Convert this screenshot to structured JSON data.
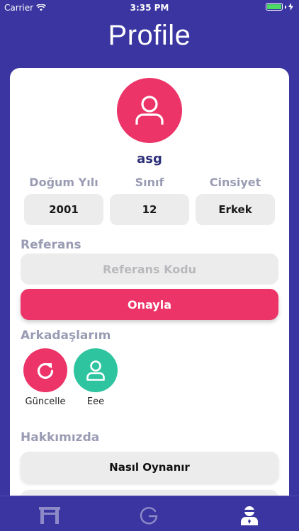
{
  "status_bar": {
    "carrier": "Carrier",
    "time": "3:35 PM"
  },
  "header": {
    "title": "Profile"
  },
  "profile": {
    "username": "asg",
    "fields": [
      {
        "label": "Doğum Yılı",
        "value": "2001"
      },
      {
        "label": "Sınıf",
        "value": "12"
      },
      {
        "label": "Cinsiyet",
        "value": "Erkek"
      }
    ]
  },
  "referral": {
    "section_label": "Referans",
    "placeholder": "Referans Kodu",
    "confirm_label": "Onayla"
  },
  "friends": {
    "section_label": "Arkadaşlarım",
    "items": [
      {
        "name": "Güncelle",
        "icon": "refresh-icon",
        "color": "#ec3468"
      },
      {
        "name": "Eee",
        "icon": "user-icon",
        "color": "#2ec4a0"
      }
    ]
  },
  "about": {
    "section_label": "Hakkımızda",
    "items": [
      "Nasıl Oynanır"
    ]
  },
  "tab_bar": {
    "items": [
      {
        "icon": "arch-icon",
        "active": false
      },
      {
        "icon": "g-logo-icon",
        "active": false
      },
      {
        "icon": "profile-icon",
        "active": true
      }
    ]
  },
  "colors": {
    "primary": "#3a35a0",
    "accent": "#ec3468",
    "friend_green": "#2ec4a0",
    "label_gray": "#9a9cb4"
  }
}
